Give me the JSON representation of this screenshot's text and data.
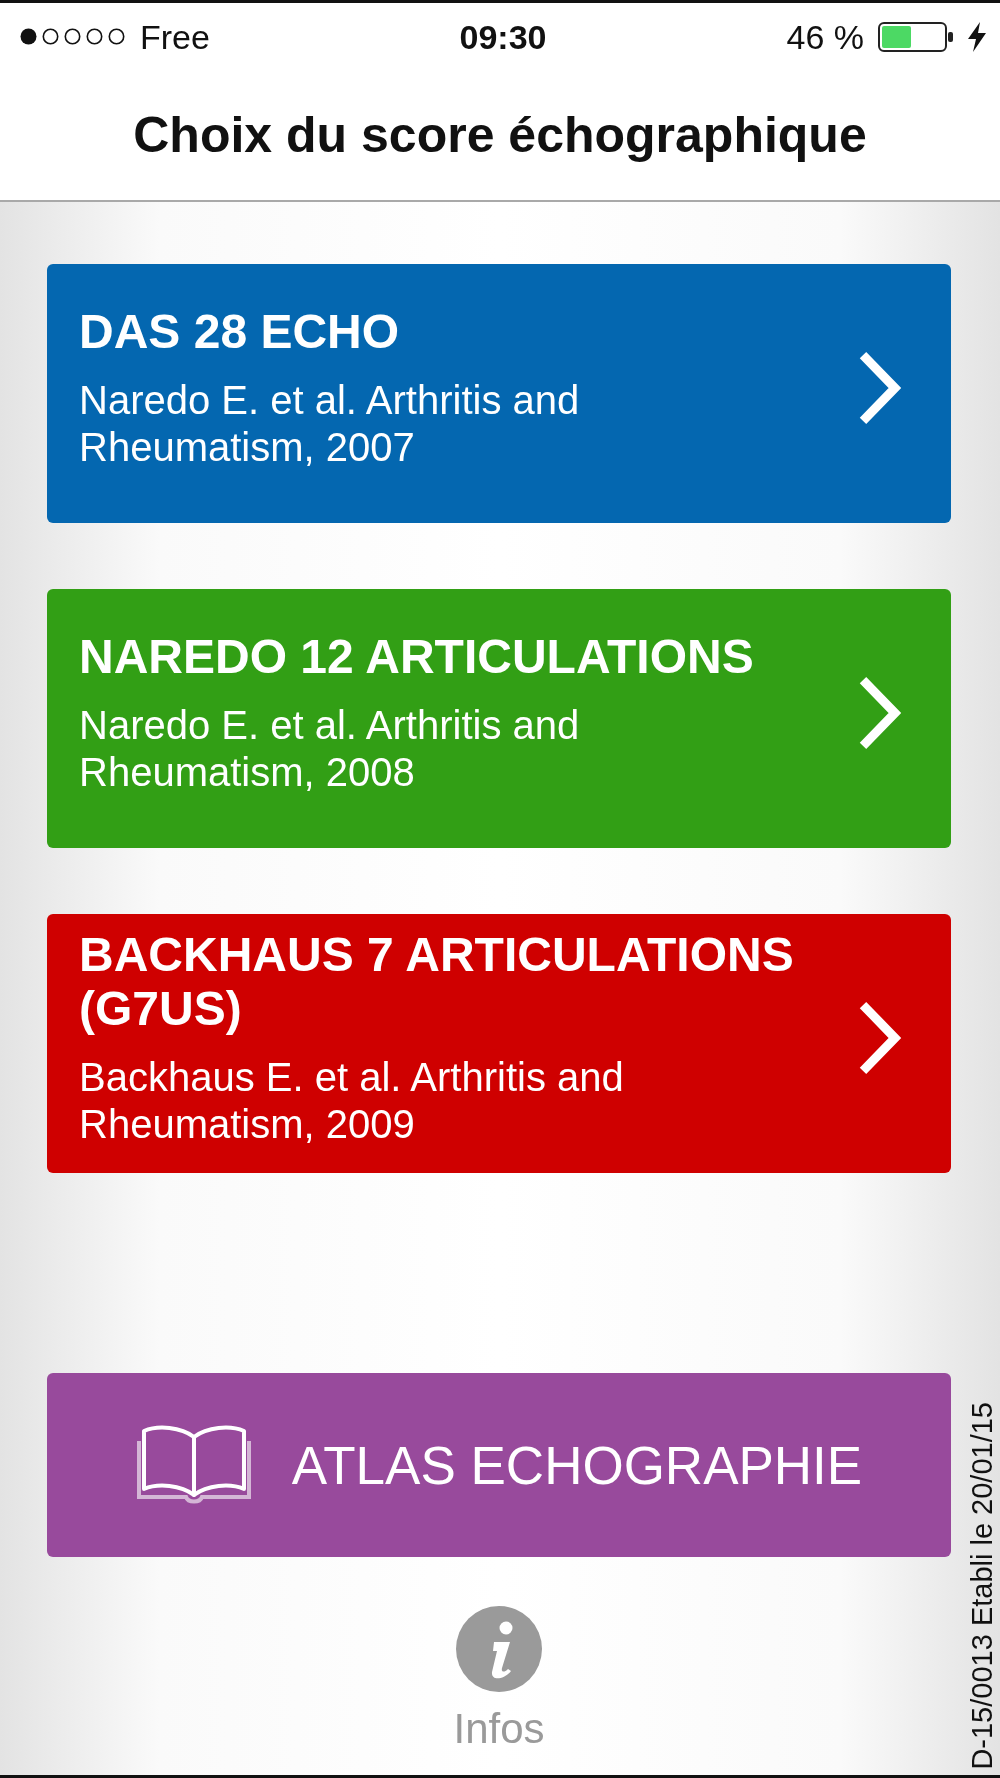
{
  "status_bar": {
    "carrier": "Free",
    "time": "09:30",
    "battery": "46 %"
  },
  "header": {
    "title": "Choix du score échographique"
  },
  "scores": [
    {
      "title": "DAS 28 ECHO",
      "reference": "Naredo E. et al. Arthritis and Rheumatism, 2007",
      "color": "#0467b0"
    },
    {
      "title": "NAREDO 12 ARTICULATIONS",
      "reference": "Naredo E. et al. Arthritis and Rheumatism, 2008",
      "color": "#329f15"
    },
    {
      "title": "BACKHAUS 7 ARTICULATIONS (G7US)",
      "reference": "Backhaus E. et al. Arthritis and Rheumatism, 2009",
      "color": "#cf0000"
    }
  ],
  "atlas_button": {
    "label": "ATLAS ECHOGRAPHIE"
  },
  "info_button": {
    "label": "Infos"
  },
  "document_code": "D-15/0013 Etabli le 20/01/15"
}
